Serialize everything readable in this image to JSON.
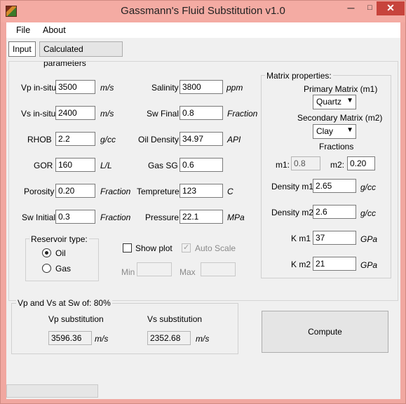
{
  "window": {
    "title": "Gassmann's Fluid Substitution v1.0",
    "min": "─",
    "max": "□",
    "close": "✕"
  },
  "menu": {
    "file": "File",
    "about": "About"
  },
  "tabs": {
    "input": "Input",
    "calculated": "Calculated parameters"
  },
  "left": {
    "vp_label": "Vp in-situ",
    "vp_value": "3500",
    "vp_unit": "m/s",
    "vs_label": "Vs in-situ",
    "vs_value": "2400",
    "vs_unit": "m/s",
    "rhob_label": "RHOB",
    "rhob_value": "2.2",
    "rhob_unit": "g/cc",
    "gor_label": "GOR",
    "gor_value": "160",
    "gor_unit": "L/L",
    "porosity_label": "Porosity",
    "porosity_value": "0.20",
    "porosity_unit": "Fraction",
    "swi_label": "Sw Initial",
    "swi_value": "0.3",
    "swi_unit": "Fraction"
  },
  "middle": {
    "salinity_label": "Salinity",
    "salinity_value": "3800",
    "salinity_unit": "ppm",
    "swf_label": "Sw Final",
    "swf_value": "0.8",
    "swf_unit": "Fraction",
    "oil_label": "Oil Density",
    "oil_value": "34.97",
    "oil_unit": "API",
    "gassg_label": "Gas SG",
    "gassg_value": "0.6",
    "temp_label": "Tempreture",
    "temp_value": "123",
    "temp_unit": "C",
    "press_label": "Pressure",
    "press_value": "22.1",
    "press_unit": "MPa"
  },
  "reservoir": {
    "title": "Reservoir type:",
    "oil": "Oil",
    "gas": "Gas"
  },
  "plot": {
    "show": "Show plot",
    "auto": "Auto Scale",
    "min": "Min",
    "max": "Max"
  },
  "matrix": {
    "title": "Matrix properties:",
    "primary_label": "Primary Matrix (m1)",
    "primary_value": "Quartz",
    "secondary_label": "Secondary Matrix (m2)",
    "secondary_value": "Clay",
    "fractions": "Fractions",
    "m1_label": "m1:",
    "m1_value": "0.8",
    "m2_label": "m2:",
    "m2_value": "0.20",
    "dm1_label": "Density m1",
    "dm1_value": "2.65",
    "dm1_unit": "g/cc",
    "dm2_label": "Density m2",
    "dm2_value": "2.6",
    "dm2_unit": "g/cc",
    "km1_label": "K m1",
    "km1_value": "37",
    "km1_unit": "GPa",
    "km2_label": "K m2",
    "km2_value": "21",
    "km2_unit": "GPa"
  },
  "result": {
    "title": "Vp and Vs at Sw of: 80%",
    "vp_label": "Vp substitution",
    "vp_value": "3596.36",
    "vp_unit": "m/s",
    "vs_label": "Vs substitution",
    "vs_value": "2352.68",
    "vs_unit": "m/s"
  },
  "compute": "Compute",
  "colors": {
    "frame": "#f1a7a0",
    "close": "#c7443c",
    "client": "#f0f0f0"
  }
}
